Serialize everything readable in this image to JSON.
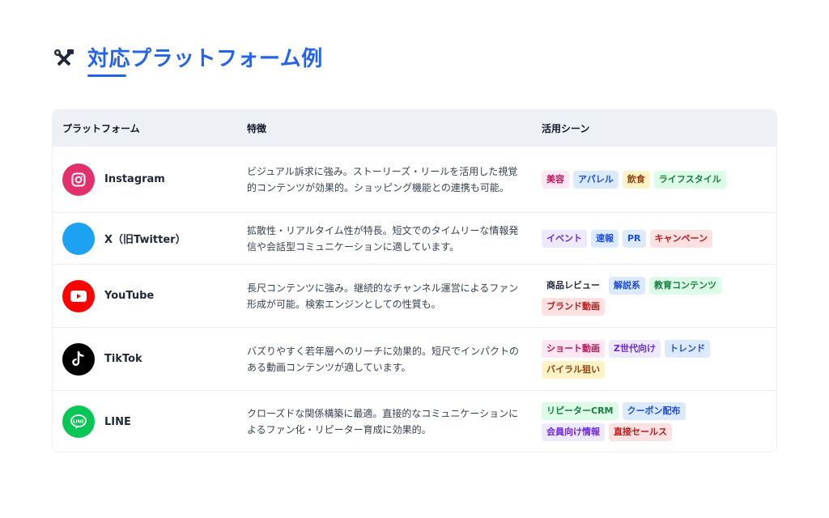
{
  "title": "対応プラットフォーム例",
  "title_icon": "tools-icon",
  "headers": {
    "platform": "プラットフォーム",
    "features": "特徴",
    "scenes": "活用シーン"
  },
  "rows": [
    {
      "name": "Instagram",
      "icon": "instagram-icon",
      "color": "#e1306c",
      "desc": "ビジュアル訴求に強み。ストーリーズ・リールを活用した視覚的コンテンツが効果的。ショッピング機能との連携も可能。",
      "tags": [
        {
          "label": "美容",
          "style": "pink"
        },
        {
          "label": "アパレル",
          "style": "blue"
        },
        {
          "label": "飲食",
          "style": "yellow"
        },
        {
          "label": "ライフスタイル",
          "style": "green"
        }
      ]
    },
    {
      "name": "X（旧Twitter）",
      "icon": "x-twitter-icon",
      "color": "#1da1f2",
      "desc": "拡散性・リアルタイム性が特長。短文でのタイムリーな情報発信や会話型コミュニケーションに適しています。",
      "tags": [
        {
          "label": "イベント",
          "style": "purple"
        },
        {
          "label": "速報",
          "style": "blue"
        },
        {
          "label": "PR",
          "style": "blue"
        },
        {
          "label": "キャンペーン",
          "style": "red"
        }
      ]
    },
    {
      "name": "YouTube",
      "icon": "youtube-icon",
      "color": "#ff0000",
      "desc": "長尺コンテンツに強み。継続的なチャンネル運営によるファン形成が可能。検索エンジンとしての性質も。",
      "tags": [
        {
          "label": "商品レビュー",
          "style": "plain"
        },
        {
          "label": "解説系",
          "style": "blue"
        },
        {
          "label": "教育コンテンツ",
          "style": "green"
        },
        {
          "label": "ブランド動画",
          "style": "red"
        }
      ]
    },
    {
      "name": "TikTok",
      "icon": "tiktok-icon",
      "color": "#000000",
      "desc": "バズりやすく若年層へのリーチに効果的。短尺でインパクトのある動画コンテンツが適しています。",
      "tags": [
        {
          "label": "ショート動画",
          "style": "pink"
        },
        {
          "label": "Z世代向け",
          "style": "purple"
        },
        {
          "label": "トレンド",
          "style": "blue"
        },
        {
          "label": "バイラル狙い",
          "style": "yellow"
        }
      ]
    },
    {
      "name": "LINE",
      "icon": "line-icon",
      "color": "#06c755",
      "desc": "クローズドな関係構築に最適。直接的なコミュニケーションによるファン化・リピーター育成に効果的。",
      "tags": [
        {
          "label": "リピーターCRM",
          "style": "green"
        },
        {
          "label": "クーポン配布",
          "style": "blue"
        },
        {
          "label": "会員向け情報",
          "style": "purple"
        },
        {
          "label": "直接セールス",
          "style": "red"
        }
      ]
    }
  ]
}
